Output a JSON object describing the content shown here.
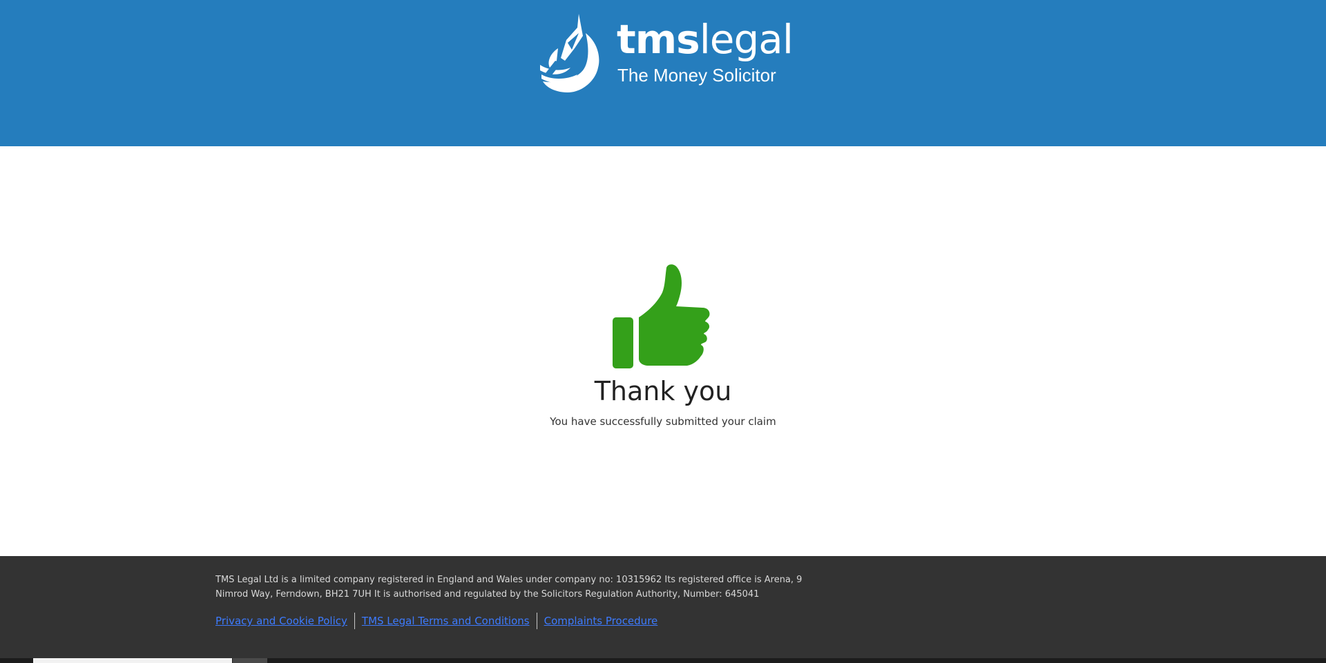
{
  "brand": {
    "name_bold": "tms",
    "name_light": "legal",
    "tagline": "The Money Solicitor",
    "color": "#257dbd"
  },
  "confirmation": {
    "icon": "thumbs-up-icon",
    "icon_color": "#34a01a",
    "title": "Thank you",
    "message": "You have successfully submitted your claim"
  },
  "footer": {
    "legal_text": "TMS Legal Ltd is a limited company registered in England and Wales under company no: 10315962 Its registered office is Arena, 9 Nimrod Way, Ferndown, BH21 7UH It is authorised and regulated by the Solicitors Regulation Authority, Number: 645041",
    "links": [
      {
        "label": "Privacy and Cookie Policy"
      },
      {
        "label": "TMS Legal Terms and Conditions"
      },
      {
        "label": "Complaints Procedure"
      }
    ],
    "background": "#333333",
    "link_color": "#3d7bff"
  }
}
